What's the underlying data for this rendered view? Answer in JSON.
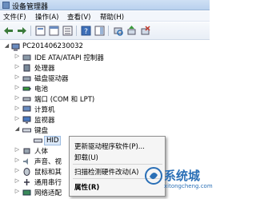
{
  "window": {
    "title": "设备管理器"
  },
  "menu": {
    "file": "文件(F)",
    "action": "操作(A)",
    "view": "查看(V)",
    "help": "帮助(H)"
  },
  "tree": {
    "root": "PC201406230032",
    "items": [
      {
        "label": "IDE ATA/ATAPI 控制器"
      },
      {
        "label": "处理器"
      },
      {
        "label": "磁盘驱动器"
      },
      {
        "label": "电池"
      },
      {
        "label": "端口 (COM 和 LPT)"
      },
      {
        "label": "计算机"
      },
      {
        "label": "监视器"
      },
      {
        "label": "键盘"
      },
      {
        "label": "HID"
      },
      {
        "label": "人体"
      },
      {
        "label": "声音、视"
      },
      {
        "label": "鼠标和其"
      },
      {
        "label": "通用串行"
      },
      {
        "label": "网络适配"
      }
    ]
  },
  "context_menu": {
    "items": [
      {
        "label": "更新驱动程序软件(P)..."
      },
      {
        "label": "卸载(U)"
      },
      {
        "label": "扫描检测硬件改动(A)"
      },
      {
        "label": "属性(R)"
      }
    ]
  },
  "watermark": {
    "name": "系统城",
    "url": "xitongcheng.com"
  },
  "colors": {
    "accent": "#2a6fb6",
    "selection": "#dbe8f8",
    "title_bar": "#c4d8f1"
  }
}
